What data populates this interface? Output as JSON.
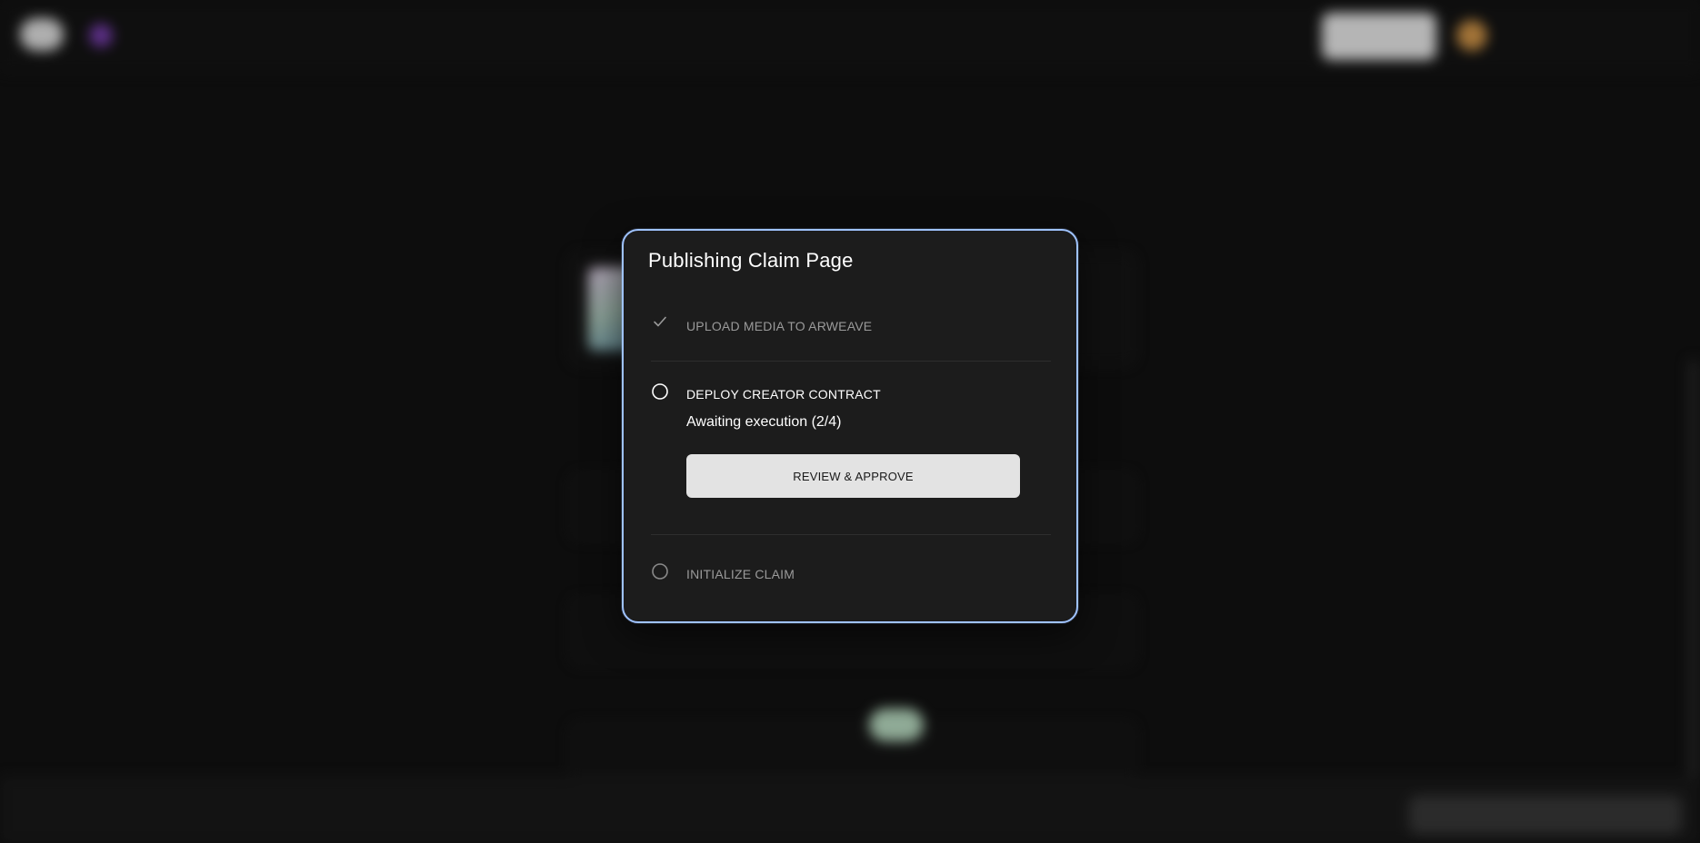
{
  "modal": {
    "title": "Publishing Claim Page",
    "steps": [
      {
        "label": "UPLOAD MEDIA TO ARWEAVE",
        "state": "complete",
        "icon": "check-icon"
      },
      {
        "label": "DEPLOY CREATOR CONTRACT",
        "state": "active",
        "icon": "circle-outline-icon",
        "status": "Awaiting execution (2/4)",
        "button_label": "REVIEW & APPROVE"
      },
      {
        "label": "INITIALIZE CLAIM",
        "state": "pending",
        "icon": "circle-outline-icon"
      }
    ]
  },
  "colors": {
    "modal_border": "#9fc3ff",
    "modal_bg": "#1c1c1c",
    "button_bg": "#e3e3e3",
    "page_bg": "#121212",
    "muted_text": "#9a9a9a"
  }
}
